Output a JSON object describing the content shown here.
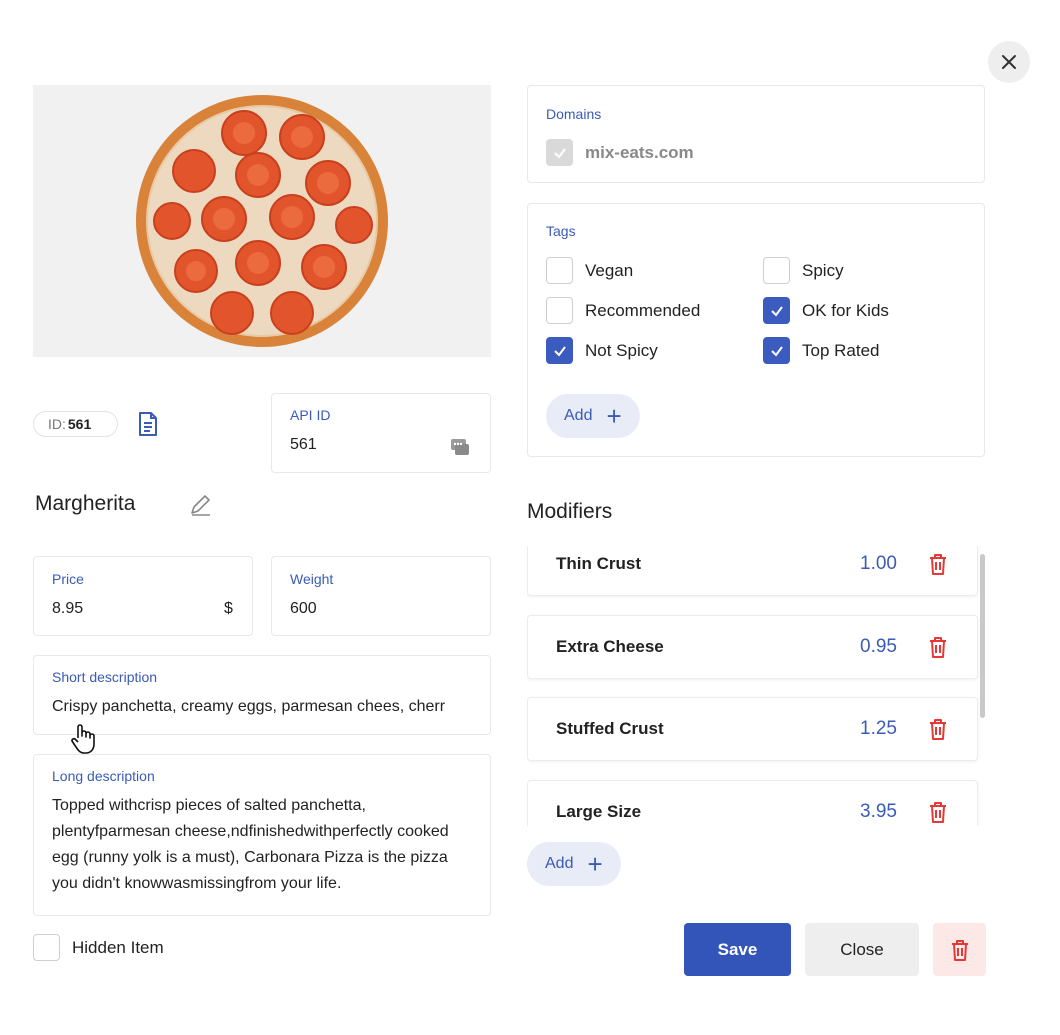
{
  "item": {
    "id_prefix": "ID:",
    "id_value": "561",
    "name": "Margherita"
  },
  "api_id": {
    "label": "API ID",
    "value": "561"
  },
  "price": {
    "label": "Price",
    "value": "8.95",
    "currency": "$"
  },
  "weight": {
    "label": "Weight",
    "value": "600"
  },
  "short_description": {
    "label": "Short description",
    "value": "Crispy panchetta, creamy eggs, parmesan chees, cherr"
  },
  "long_description": {
    "label": "Long description",
    "value": "Topped withcrisp pieces of salted panchetta, plentyfparmesan cheese,ndfinishedwithperfectly cooked egg (runny yolk is a must), Carbonara Pizza is the pizza you didn't knowwasmissingfrom your life."
  },
  "hidden_item": {
    "label": "Hidden Item",
    "checked": false
  },
  "domains": {
    "label": "Domains",
    "items": [
      {
        "label": "mix-eats.com",
        "checked": true,
        "disabled": true
      }
    ]
  },
  "tags": {
    "label": "Tags",
    "items": [
      {
        "label": "Vegan",
        "checked": false
      },
      {
        "label": "Spicy",
        "checked": false
      },
      {
        "label": "Recommended",
        "checked": false
      },
      {
        "label": "OK for Kids",
        "checked": true
      },
      {
        "label": "Not Spicy",
        "checked": true
      },
      {
        "label": "Top Rated",
        "checked": true
      }
    ],
    "add_label": "Add"
  },
  "modifiers": {
    "title": "Modifiers",
    "items": [
      {
        "name": "Thin Crust",
        "price": "1.00"
      },
      {
        "name": "Extra Cheese",
        "price": "0.95"
      },
      {
        "name": "Stuffed Crust",
        "price": "1.25"
      },
      {
        "name": "Large Size",
        "price": "3.95"
      }
    ],
    "add_label": "Add"
  },
  "buttons": {
    "save": "Save",
    "close": "Close"
  },
  "colors": {
    "accent": "#3354b8",
    "danger": "#e53935",
    "danger_bg": "#fde8e8"
  }
}
